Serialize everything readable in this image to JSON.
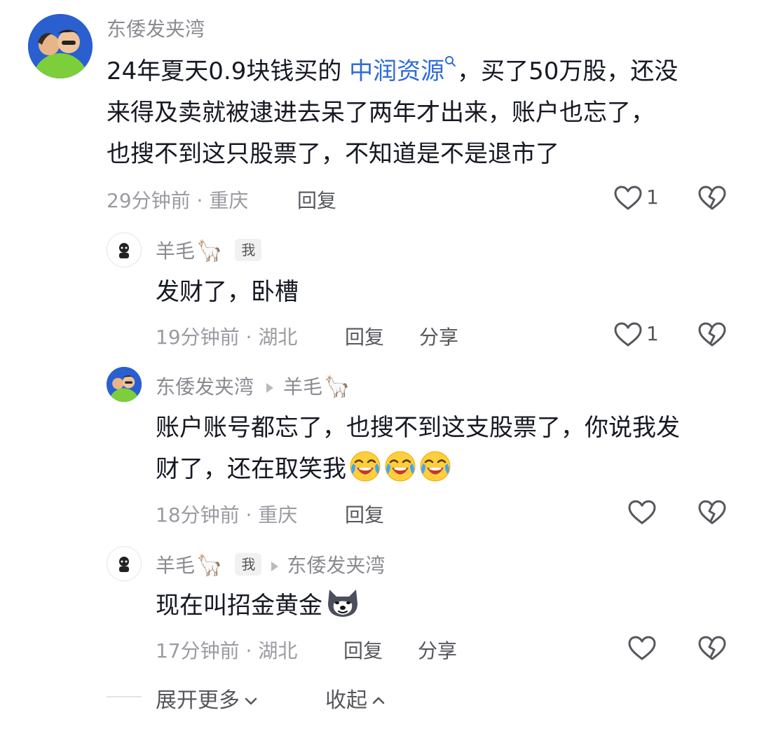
{
  "comments": [
    {
      "author": "东倭发夹湾",
      "text_before": "24年夏天0.9块钱买的 ",
      "link_text": "中润资源",
      "text_after": "，买了50万股，还没",
      "line2": "来得及卖就被逮进去呆了两年才出来，账户也忘了，",
      "line3": "也搜不到这只股票了，不知道是不是退市了",
      "time_location": "29分钟前 · 重庆",
      "reply_label": "回复",
      "like_count": "1"
    }
  ],
  "replies": [
    {
      "author": "羊毛",
      "author_emoji": "🦙",
      "badge": "我",
      "text": "发财了，卧槽",
      "time_location": "19分钟前 · 湖北",
      "reply_label": "回复",
      "share_label": "分享",
      "like_count": "1"
    },
    {
      "author": "东倭发夹湾",
      "reply_to": "羊毛",
      "reply_to_emoji": "🦙",
      "line1": "账户账号都忘了，也搜不到这支股票了，你说我发",
      "line2": "财了，还在取笑我",
      "time_location": "18分钟前 · 重庆",
      "reply_label": "回复"
    },
    {
      "author": "羊毛",
      "author_emoji": "🦙",
      "badge": "我",
      "reply_to": "东倭发夹湾",
      "text": "现在叫招金黄金",
      "time_location": "17分钟前 · 湖北",
      "reply_label": "回复",
      "share_label": "分享"
    }
  ],
  "footer": {
    "expand_more": "展开更多",
    "collapse": "收起"
  },
  "icons": {
    "like": "heart-outline-icon",
    "dislike": "broken-heart-icon",
    "search": "search-icon",
    "crying_laugh": "crying-laughing-emoji",
    "dog": "dog-face-emoji",
    "chevron_down": "chevron-down-icon",
    "chevron_up": "chevron-up-icon"
  },
  "colors": {
    "link": "#2f6cd8",
    "meta": "#9a9ba1",
    "text": "#161823"
  }
}
